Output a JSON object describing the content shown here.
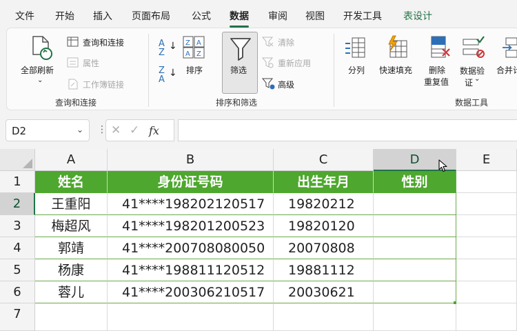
{
  "tabs": [
    "文件",
    "开始",
    "插入",
    "页面布局",
    "公式",
    "数据",
    "审阅",
    "视图",
    "开发工具",
    "表设计"
  ],
  "active_tab": "数据",
  "ribbon": {
    "refresh_all": "全部刷新",
    "query_connect": "查询和连接",
    "properties": "属性",
    "workbook_links": "工作簿链接",
    "group_query": "查询和连接",
    "sort": "排序",
    "filter": "筛选",
    "clear": "清除",
    "reapply": "重新应用",
    "advanced": "高级",
    "group_sort_filter": "排序和筛选",
    "text_to_columns": "分列",
    "flash_fill": "快速填充",
    "remove_dup_1": "删除",
    "remove_dup_2": "重复值",
    "validation_1": "数据验",
    "validation_2": "证",
    "consolidate": "合并计",
    "group_data_tools": "数据工具"
  },
  "formula_bar": {
    "name_box": "D2",
    "fx": "fx",
    "cancel": "✕",
    "enter": "✓",
    "formula": ""
  },
  "grid": {
    "columns": [
      "A",
      "B",
      "C",
      "D",
      "E"
    ],
    "selected_column": "D",
    "rows": [
      "1",
      "2",
      "3",
      "4",
      "5",
      "6",
      "7"
    ],
    "selected_row": "2",
    "headers": [
      "姓名",
      "身份证号码",
      "出生年月",
      "性别"
    ],
    "data": [
      [
        "王重阳",
        "41****198202120517",
        "19820212",
        ""
      ],
      [
        "梅超风",
        "41****198201200523",
        "19820120",
        ""
      ],
      [
        "郭靖",
        "41****200708080050",
        "20070808",
        ""
      ],
      [
        "杨康",
        "41****198811120512",
        "19881112",
        ""
      ],
      [
        "蓉儿",
        "41****200306210517",
        "20030621",
        ""
      ]
    ]
  },
  "colors": {
    "accent": "#217346",
    "table_header": "#4ea72e"
  }
}
